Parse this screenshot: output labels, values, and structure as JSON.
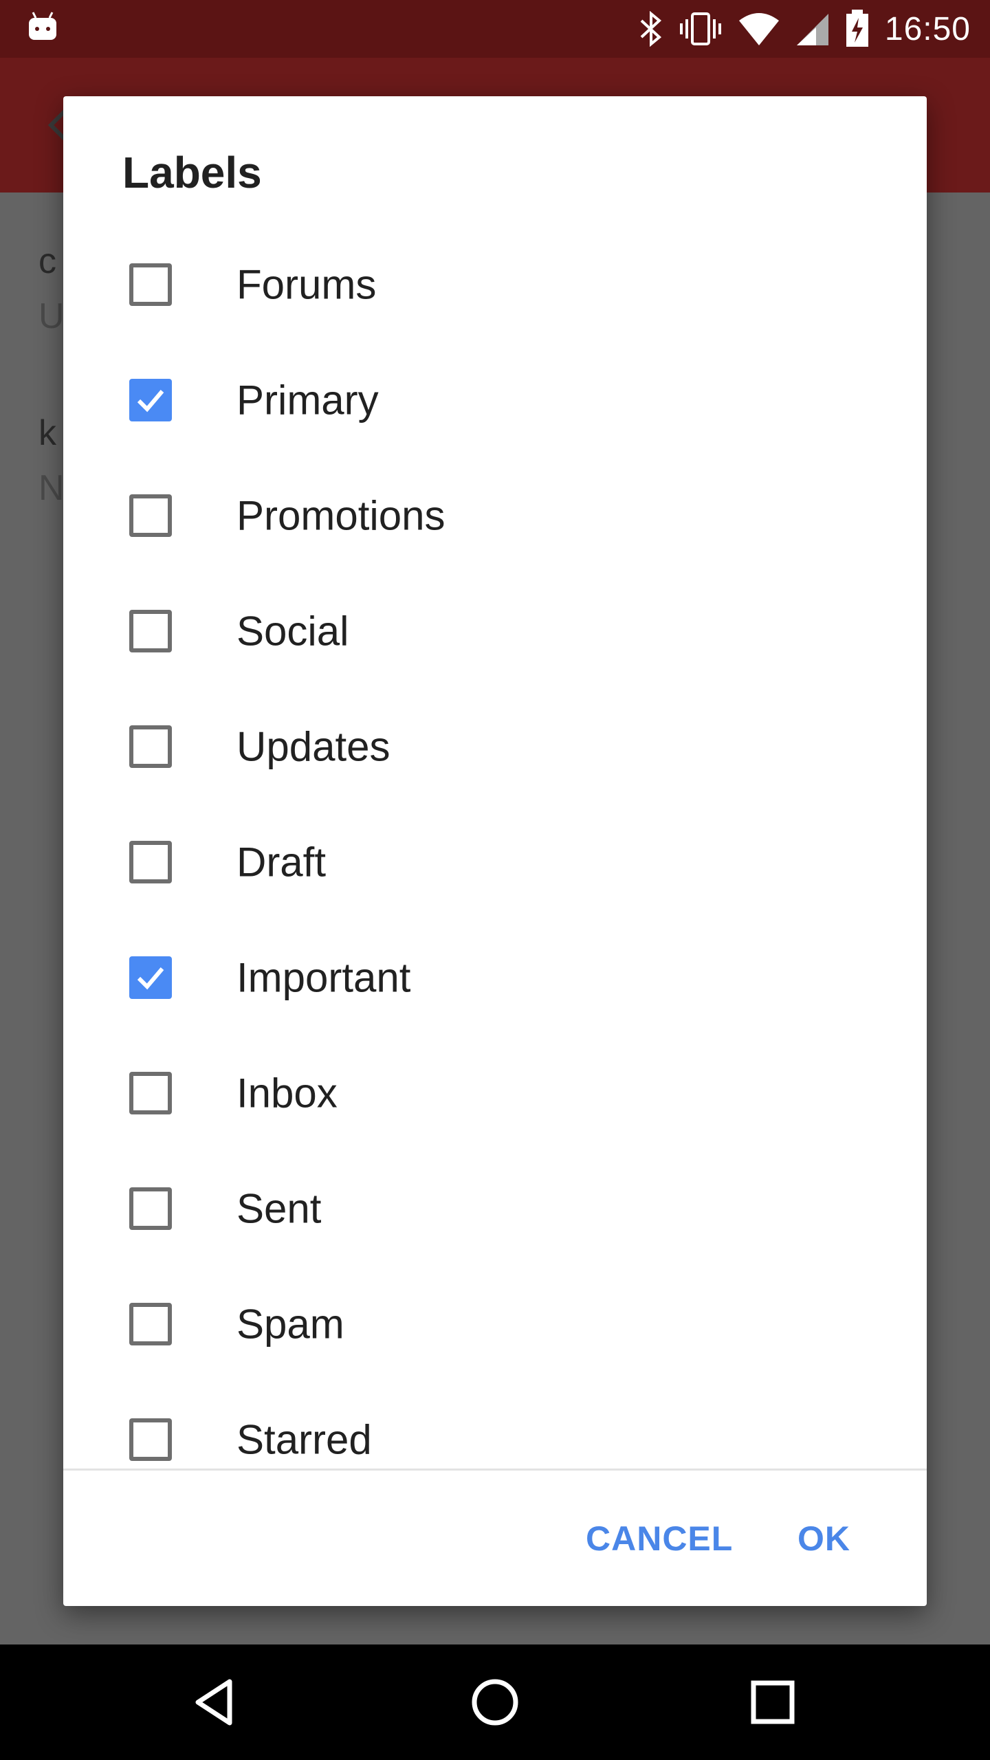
{
  "status_bar": {
    "time": "16:50",
    "icons": [
      "android-debug-icon",
      "bluetooth-icon",
      "vibrate-icon",
      "wifi-icon",
      "cell-signal-icon",
      "battery-charging-icon"
    ]
  },
  "app_bar": {
    "icons": [
      "back-arrow-icon"
    ]
  },
  "background_items": [
    {
      "line1": "c",
      "line2": "U"
    },
    {
      "line1": "k",
      "line2": "N"
    }
  ],
  "dialog": {
    "title": "Labels",
    "labels": [
      {
        "name": "Forums",
        "checked": false
      },
      {
        "name": "Primary",
        "checked": true
      },
      {
        "name": "Promotions",
        "checked": false
      },
      {
        "name": "Social",
        "checked": false
      },
      {
        "name": "Updates",
        "checked": false
      },
      {
        "name": "Draft",
        "checked": false
      },
      {
        "name": "Important",
        "checked": true
      },
      {
        "name": "Inbox",
        "checked": false
      },
      {
        "name": "Sent",
        "checked": false
      },
      {
        "name": "Spam",
        "checked": false
      },
      {
        "name": "Starred",
        "checked": false
      }
    ],
    "cancel_label": "CANCEL",
    "ok_label": "OK"
  },
  "nav_bar": {
    "icons": [
      "back-triangle-icon",
      "home-circle-icon",
      "recents-square-icon"
    ]
  },
  "colors": {
    "status_bar": "#5b1414",
    "app_bar": "#6b1a1a",
    "accent": "#4a8af4",
    "button_text": "#4a86e8"
  }
}
